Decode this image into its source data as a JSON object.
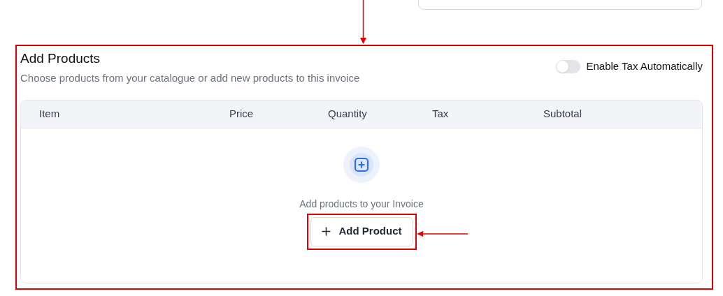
{
  "section": {
    "title": "Add Products",
    "subtitle": "Choose products from your catalogue or add new products to this invoice"
  },
  "tax_toggle": {
    "label": "Enable Tax Automatically",
    "on": false
  },
  "table": {
    "columns": [
      "Item",
      "Price",
      "Quantity",
      "Tax",
      "Subtotal"
    ]
  },
  "empty_state": {
    "message": "Add products to your Invoice",
    "button": "Add Product"
  }
}
